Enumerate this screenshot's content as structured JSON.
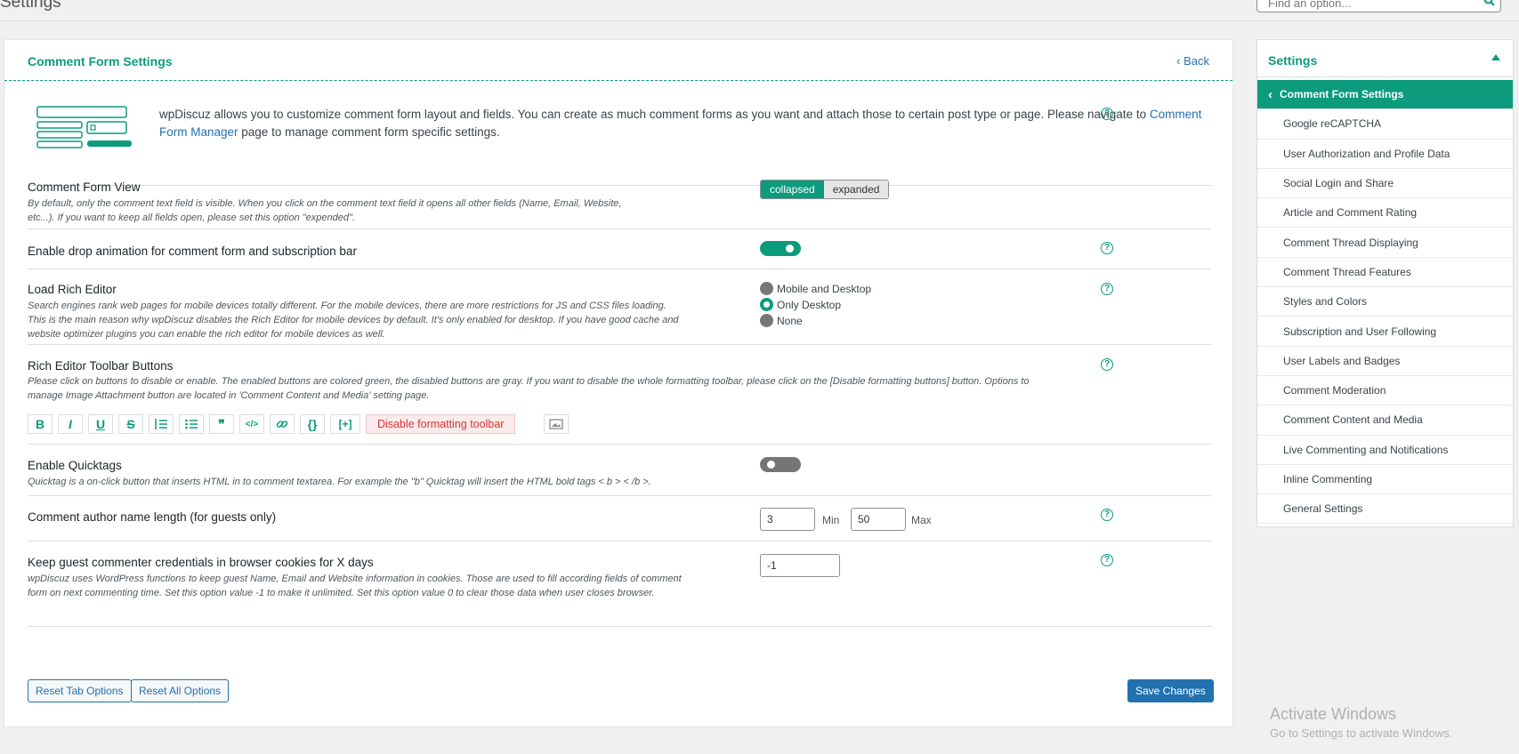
{
  "page": {
    "title": "Settings",
    "search_placeholder": "Find an option..."
  },
  "panel": {
    "title": "Comment Form Settings",
    "back": "Back",
    "intro_before_link": "wpDiscuz allows you to customize comment form layout and fields. You can create as much comment forms as you want and attach those to certain post type or page. Please navigate to",
    "intro_link": "Comment Form Manager",
    "intro_after_link": " page to manage comment form specific settings."
  },
  "options": {
    "form_view": {
      "label": "Comment Form View",
      "desc": "By default, only the comment text field is visible. When you click on the comment text field it opens all other fields (Name, Email, Website, etc...). If you want to keep all fields open, please set this option \"expended\".",
      "collapsed": "collapsed",
      "expanded": "expanded",
      "selected": "collapsed"
    },
    "drop_animation": {
      "label": "Enable drop animation for comment form and subscription bar",
      "enabled": true
    },
    "rich_editor": {
      "label": "Load Rich Editor",
      "desc": "Search engines rank web pages for mobile devices totally different. For the mobile devices, there are more restrictions for JS and CSS files loading. This is the main reason why wpDiscuz disables the Rich Editor for mobile devices by default. It's only enabled for desktop. If you have good cache and website optimizer plugins you can enable the rich editor for mobile devices as well.",
      "choices": [
        "Mobile and Desktop",
        "Only Desktop",
        "None"
      ],
      "selected": "Only Desktop"
    },
    "toolbar": {
      "label": "Rich Editor Toolbar Buttons",
      "desc": "Please click on buttons to disable or enable. The enabled buttons are colored green, the disabled buttons are gray. If you want to disable the whole formatting toolbar, please click on the [Disable formatting buttons] button. Options to manage Image Attachment button are located in 'Comment Content and Media' setting page.",
      "disable_label": "Disable formatting toolbar",
      "buttons": [
        "B",
        "I",
        "U",
        "S",
        "ol",
        "ul",
        "quote",
        "code",
        "link",
        "{}",
        "[+]"
      ]
    },
    "quicktags": {
      "label": "Enable Quicktags",
      "desc": "Quicktag is a on-click button that inserts HTML in to comment textarea. For example the \"b\" Quicktag will insert the HTML bold tags < b > < /b >.",
      "enabled": false
    },
    "name_length": {
      "label": "Comment author name length (for guests only)",
      "min": "3",
      "min_label": "Min",
      "max": "50",
      "max_label": "Max"
    },
    "cookie_days": {
      "label": "Keep guest commenter credentials in browser cookies for X days",
      "desc": "wpDiscuz uses WordPress functions to keep guest Name, Email and Website information in cookies. Those are used to fill according fields of comment form on next commenting time. Set this option value -1 to make it unlimited. Set this option value 0 to clear those data when user closes browser.",
      "value": "-1"
    }
  },
  "footer": {
    "reset_tab": "Reset Tab Options",
    "reset_all": "Reset All Options",
    "save": "Save Changes"
  },
  "sidebar": {
    "title": "Settings",
    "items": [
      {
        "label": "Comment Form Settings",
        "active": true
      },
      {
        "label": "Google reCAPTCHA"
      },
      {
        "label": "User Authorization and Profile Data"
      },
      {
        "label": "Social Login and Share"
      },
      {
        "label": "Article and Comment Rating"
      },
      {
        "label": "Comment Thread Displaying"
      },
      {
        "label": "Comment Thread Features"
      },
      {
        "label": "Styles and Colors"
      },
      {
        "label": "Subscription and User Following"
      },
      {
        "label": "User Labels and Badges"
      },
      {
        "label": "Comment Moderation"
      },
      {
        "label": "Comment Content and Media"
      },
      {
        "label": "Live Commenting and Notifications"
      },
      {
        "label": "Inline Commenting"
      },
      {
        "label": "General Settings"
      }
    ]
  },
  "watermark": {
    "line1": "Activate Windows",
    "line2": "Go to Settings to activate Windows."
  },
  "colors": {
    "accent": "#0c9b7d",
    "link": "#2271b1",
    "danger": "#d63638"
  }
}
